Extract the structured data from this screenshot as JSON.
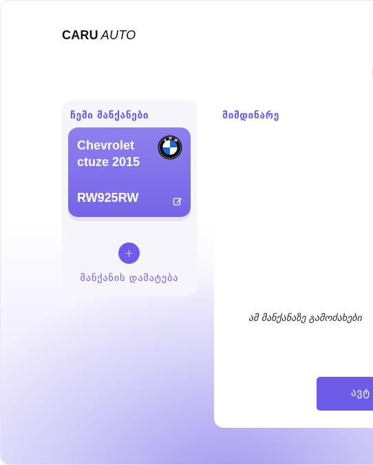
{
  "header": {
    "brand": "CARU",
    "brand_sub": "AUTO"
  },
  "my_cars": {
    "title": "ჩემი მანქანები",
    "cars": [
      {
        "name": "Chevrolet ctuze 2015",
        "plate": "RW925RW",
        "brand_icon": "bmw-logo-icon"
      }
    ],
    "add_label": "მანქანის დამატება"
  },
  "current": {
    "title": "მიმდინარე",
    "empty_text": "ამ მანქანაზე გამოძახები",
    "button_label": "ავტ"
  },
  "colors": {
    "accent": "#6c5ce7",
    "card": "#8374ea"
  }
}
